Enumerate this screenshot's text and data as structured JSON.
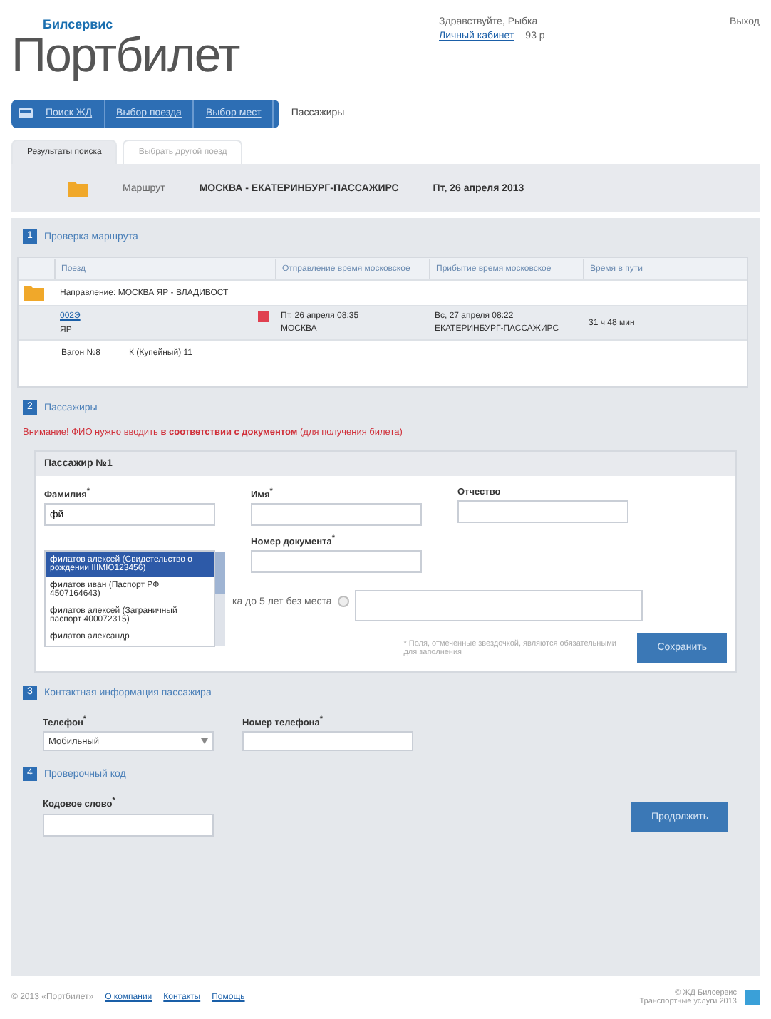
{
  "header": {
    "logo_small": "Билсервис",
    "logo": "Портбилет",
    "greeting": "Здравствуйте, Рыбка",
    "cabinet_link": "Личный кабинет",
    "balance": "93 р",
    "logout": "Выход"
  },
  "steps": [
    {
      "label": "Поиск ЖД",
      "selected": false
    },
    {
      "label": "Выбор поезда",
      "selected": false
    },
    {
      "label": "Выбор мест",
      "selected": false
    },
    {
      "label": "Пассажиры",
      "selected": true
    }
  ],
  "tabs": [
    {
      "label": "Результаты поиска",
      "selected": true
    },
    {
      "label": "Выбрать другой поезд",
      "selected": false
    }
  ],
  "route": {
    "label": "Маршрут",
    "value": "МОСКВА - ЕКАТЕРИНБУРГ-ПАССАЖИРС",
    "date": "Пт, 26 апреля 2013"
  },
  "route_check": {
    "number": "1",
    "title": "Проверка маршрута",
    "columns": [
      "Поезд",
      "Отправление время московское",
      "Прибытие время московское",
      "Время в пути"
    ],
    "direction": "Направление: МОСКВА ЯР - ВЛАДИВОСТ",
    "train": {
      "number": "002Э",
      "sub": "ЯР",
      "departure": "Пт, 26 апреля 08:35",
      "departure_station": "МОСКВА",
      "arrival": "Вс, 27 апреля 08:22",
      "arrival_station": "ЕКАТЕРИНБУРГ-ПАССАЖИРС",
      "duration": "31 ч 48 мин"
    },
    "car": "Вагон №8",
    "car_type": "К (Купейный) 11"
  },
  "passengers": {
    "number": "2",
    "title": "Пассажиры",
    "warning": "Внимание! ФИО нужно вводить **в соответствии с документом** (для получения билета)",
    "passenger_title": "Пассажир №1",
    "surname_label": "Фамилия$^{*}$",
    "surname_value": "фй",
    "name_label": "Имя$^{*}$",
    "patronymic_label": "Отчество",
    "document_label": "Номер документа$^{*}$",
    "child_label": "ка до 5 лет без места",
    "required_hint": "* Поля, отмеченные звездочкой, являются обязательными для заполнения",
    "save_button": "Сохранить",
    "suggestions": [
      {
        "text": "**фи**латов алексей (Свидетельство о рождении IIIМЮ123456)",
        "selected": true
      },
      {
        "text": "**фи**латов иван (Паспорт РФ 4507164643)",
        "selected": false
      },
      {
        "text": "**фи**латов алексей (Заграничный паспорт 400072315)",
        "selected": false
      },
      {
        "text": "**фи**латов александр",
        "selected": false
      }
    ]
  },
  "contacts": {
    "number": "3",
    "title": "Контактная информация пассажира",
    "phone_type_label": "Телефон$^{*}$",
    "phone_type_value": "Мобильный",
    "phone_label": "Номер телефона$^{*}$"
  },
  "agent": {
    "number": "4",
    "title": "Проверочный код",
    "code_label": "Кодовое слово$^{*}$",
    "continue_button": "Продолжить"
  },
  "footer": {
    "copyright": "© 2013 «Портбилет»",
    "links": [
      "О компании",
      "Контакты",
      "Помощь"
    ],
    "right_line1": "© ЖД Билсервис",
    "right_line2": "Транспортные услуги 2013"
  }
}
